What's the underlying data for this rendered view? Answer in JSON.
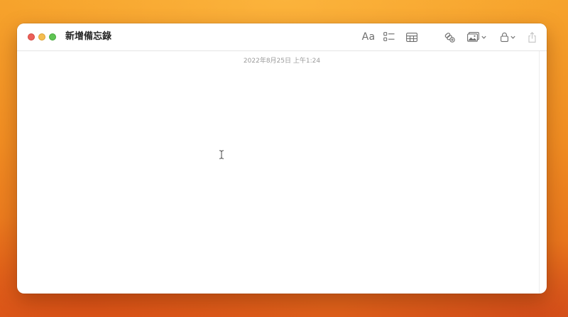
{
  "window": {
    "title": "新增備忘錄"
  },
  "toolbar": {
    "format_label": "Aa",
    "format_icon": "text-format-icon",
    "checklist_icon": "checklist-icon",
    "table_icon": "table-icon",
    "collaborate_icon": "collaborate-icon",
    "media_icon": "photo-media-icon",
    "lock_icon": "lock-icon",
    "share_icon": "share-icon"
  },
  "note": {
    "timestamp": "2022年8月25日 上午1:24",
    "body": ""
  },
  "colors": {
    "close": "#ec5f59",
    "minimize": "#f5bd4f",
    "maximize": "#5fc453",
    "icon_gray": "#6e6e6e",
    "disabled_gray": "#c4c4c4"
  }
}
